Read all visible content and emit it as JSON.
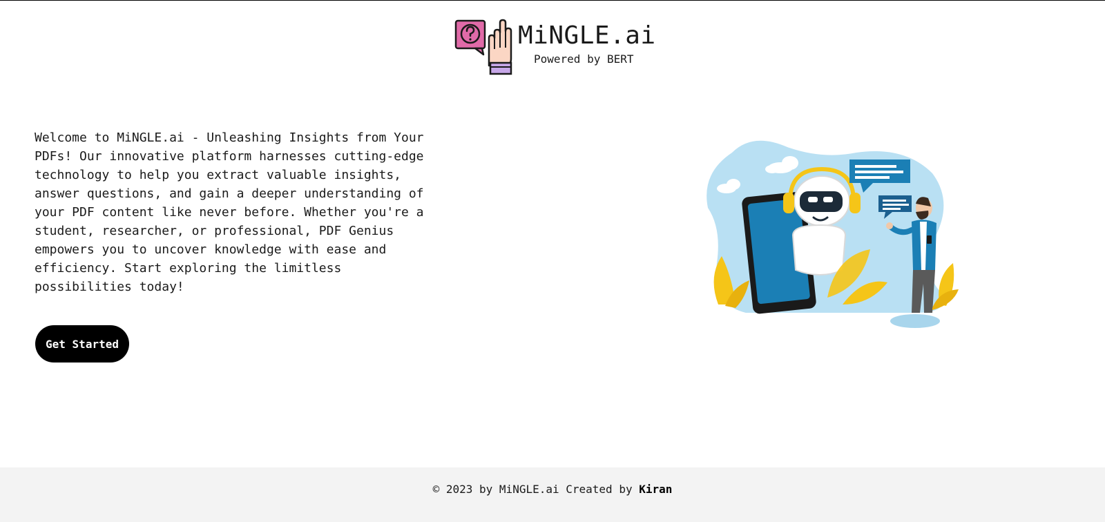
{
  "header": {
    "logo_icon": "question-hand-icon",
    "brand_name": "MiNGLE.ai",
    "tagline": "Powered by BERT"
  },
  "main": {
    "intro_text": "Welcome to MiNGLE.ai - Unleashing Insights from Your PDFs! Our innovative platform harnesses cutting-edge technology to help you extract valuable insights, answer questions, and gain a deeper understanding of your PDF content like never before. Whether you're a student, researcher, or professional, PDF Genius empowers you to uncover knowledge with ease and efficiency. Start exploring the limitless possibilities today!",
    "cta_label": "Get Started",
    "illustration": "robot-chat-illustration"
  },
  "footer": {
    "copyright_prefix": "© 2023 by MiNGLE.ai Created by ",
    "author": "Kiran"
  },
  "colors": {
    "button_bg": "#000000",
    "footer_bg": "#f3f3f3",
    "logo_pink": "#e06aa8",
    "logo_purple": "#c7a7e8",
    "illus_blue": "#b9e0f3",
    "illus_yellow": "#f5c518"
  }
}
